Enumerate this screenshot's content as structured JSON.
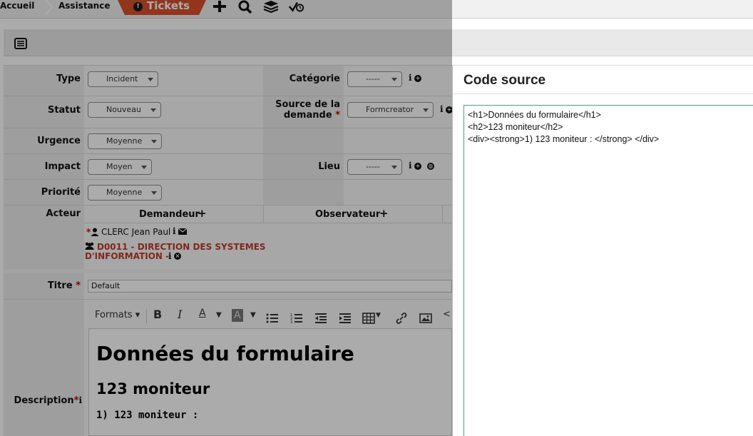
{
  "breadcrumb": {
    "home": "Accueil",
    "assistance": "Assistance",
    "tickets": "Tickets"
  },
  "toolbar_icons": [
    "plus-icon",
    "search-icon",
    "layers-icon",
    "check-clock-icon"
  ],
  "form": {
    "type": {
      "label": "Type",
      "value": "Incident"
    },
    "categorie": {
      "label": "Catégorie",
      "value": "-----"
    },
    "statut": {
      "label": "Statut",
      "value": "Nouveau"
    },
    "source": {
      "label_line1": "Source de la",
      "label_line2": "demande",
      "required": "*",
      "value": "Formcreator"
    },
    "urgence": {
      "label": "Urgence",
      "value": "Moyenne"
    },
    "impact": {
      "label": "Impact",
      "value": "Moyen"
    },
    "lieu": {
      "label": "Lieu",
      "value": "-----"
    },
    "priorite": {
      "label": "Priorité",
      "value": "Moyenne"
    },
    "acteur": {
      "label": "Acteur",
      "demandeur": "Demandeur",
      "observateur": "Observateur",
      "requester_marker": "*",
      "requester_name": "CLERC Jean Paul",
      "group_line1": "D0011 - DIRECTION DES SYSTEMES",
      "group_line2": "D'INFORMATION -"
    },
    "titre": {
      "label": "Titre",
      "required": "*",
      "value": "Default"
    },
    "description": {
      "label": "Description",
      "required": "*",
      "formats_label": "Formats",
      "content_h1": "Données du formulaire",
      "content_h2": "123 moniteur",
      "content_div": "1) 123 moniteur :"
    }
  },
  "modal": {
    "title": "Code source",
    "code": "<h1>Données du formulaire</h1>\n<h2>123 moniteur</h2>\n<div><strong>1) 123 moniteur : </strong> </div>"
  },
  "colors": {
    "accent": "#d9502c",
    "required": "#cc0000",
    "group_text": "#c0392b",
    "code_border": "#4a9e8e"
  }
}
